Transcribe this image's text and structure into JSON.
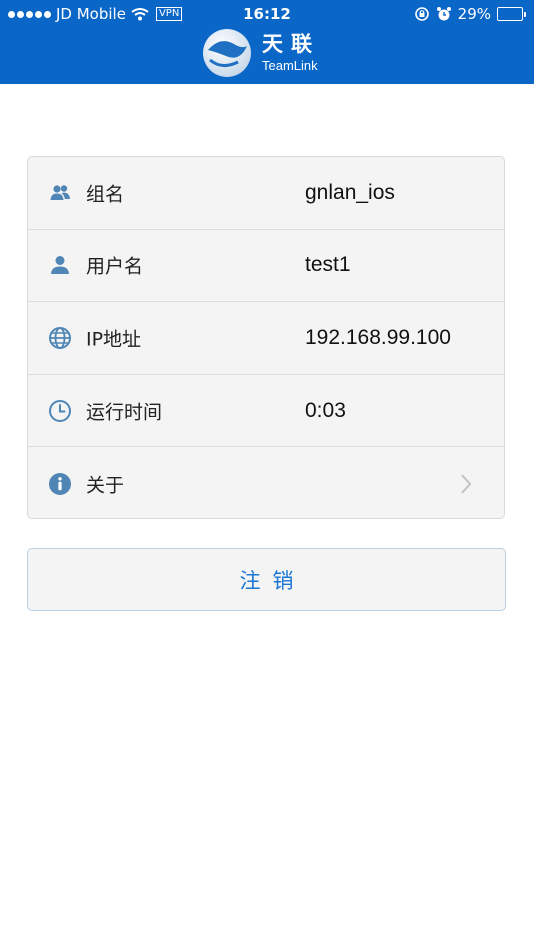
{
  "status_bar": {
    "carrier": "JD Mobile",
    "vpn": "VPN",
    "time": "16:12",
    "battery_percent": "29%",
    "battery_level": 0.29
  },
  "header": {
    "brand_cn": "天联",
    "brand_en": "TeamLink",
    "color": "#0a66c7"
  },
  "info": {
    "rows": [
      {
        "icon": "group-icon",
        "label": "组名",
        "value": "gnlan_ios"
      },
      {
        "icon": "user-icon",
        "label": "用户名",
        "value": "test1"
      },
      {
        "icon": "globe-icon",
        "label": "IP地址",
        "value": "192.168.99.100"
      },
      {
        "icon": "clock-icon",
        "label": "运行时间",
        "value": "0:03"
      },
      {
        "icon": "info-icon",
        "label": "关于",
        "value": ""
      }
    ]
  },
  "actions": {
    "logout_label": "注销"
  },
  "colors": {
    "accent": "#1a76d2",
    "icon": "#4f86b5"
  }
}
